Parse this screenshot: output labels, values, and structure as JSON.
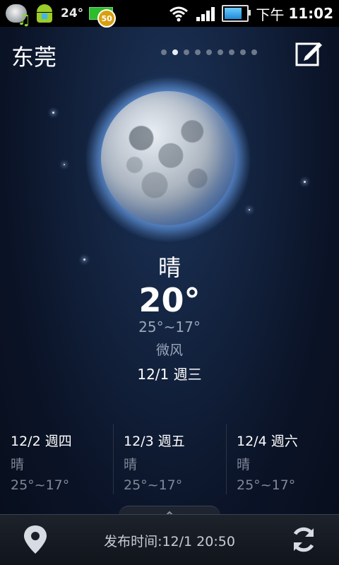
{
  "status_bar": {
    "temperature": "24°",
    "badge_count": "50",
    "time_prefix": "下午",
    "time": "11:02"
  },
  "header": {
    "city": "东莞",
    "page_count": 9,
    "active_page": 1
  },
  "current": {
    "condition": "晴",
    "temperature": "20°",
    "range": "25°~17°",
    "wind": "微风",
    "date": "12/1 週三"
  },
  "forecast": [
    {
      "date": "12/2 週四",
      "condition": "晴",
      "range": "25°~17°"
    },
    {
      "date": "12/3 週五",
      "condition": "晴",
      "range": "25°~17°"
    },
    {
      "date": "12/4 週六",
      "condition": "晴",
      "range": "25°~17°"
    }
  ],
  "bottom_bar": {
    "publish_time": "发布时间:12/1 20:50"
  },
  "icons": {
    "edit": "edit-icon",
    "location": "location-pin-icon",
    "refresh": "refresh-icon",
    "moon": "moon-icon"
  }
}
